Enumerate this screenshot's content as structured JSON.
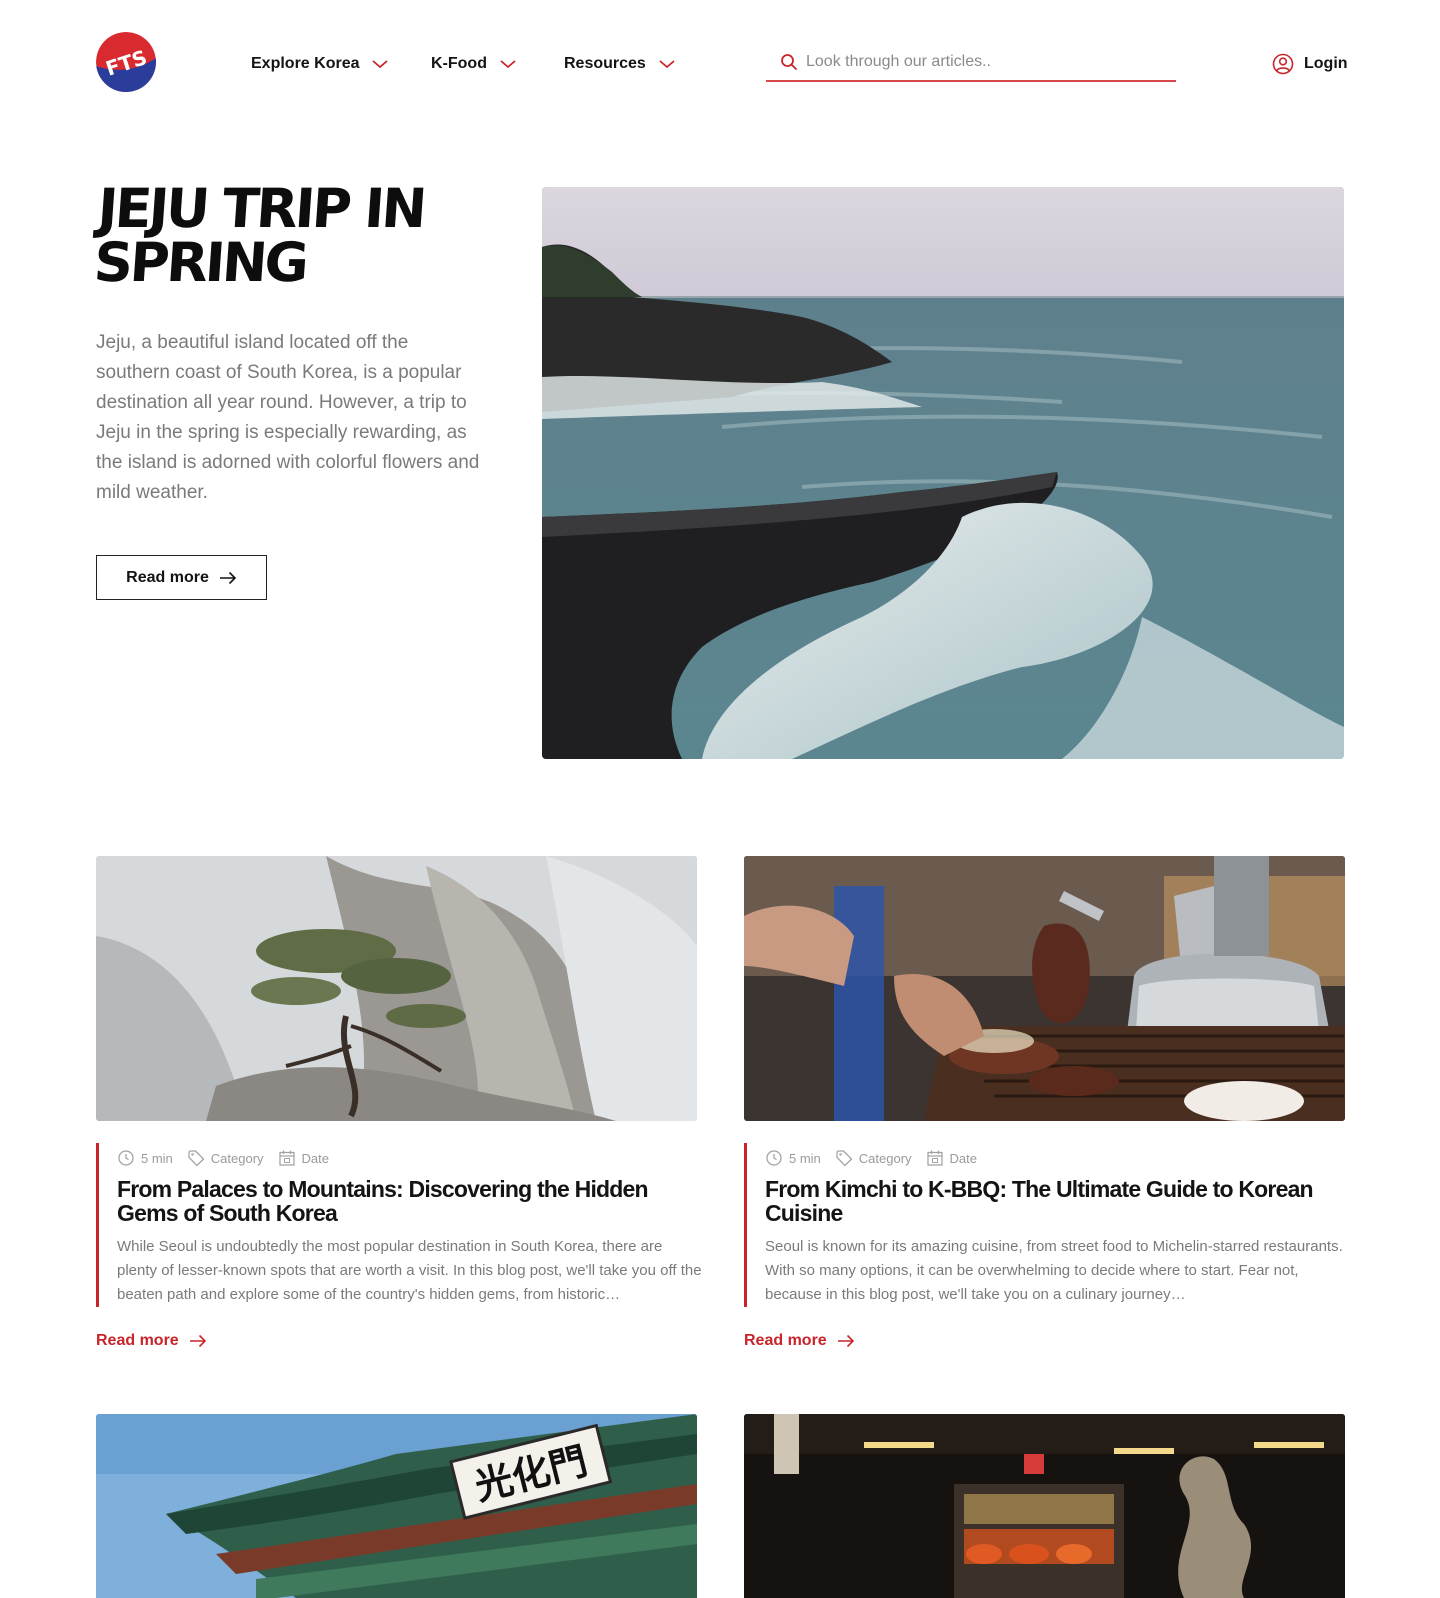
{
  "header": {
    "logo_text": "FTS",
    "nav": [
      {
        "label": "Explore Korea"
      },
      {
        "label": "K-Food"
      },
      {
        "label": "Resources"
      }
    ],
    "search": {
      "placeholder": "Look through our articles.."
    },
    "login_label": "Login"
  },
  "hero": {
    "title": "Jeju Trip in Spring",
    "description": "Jeju, a beautiful island located off the southern coast of South Korea, is a popular destination all year round. However, a trip to Jeju in the spring is especially rewarding, as the island is adorned with colorful flowers and mild weather.",
    "cta_label": "Read more"
  },
  "articles": [
    {
      "read_time": "5 min",
      "category": "Category",
      "date": "Date",
      "title": "From Palaces to Mountains: Discovering the Hidden Gems of South Korea",
      "excerpt": "While Seoul is undoubtedly the most popular destination in South Korea, there are plenty of lesser-known spots that are worth a visit. In this blog post, we'll take you off the beaten path and explore some of the country's hidden gems, from historic…",
      "read_more": "Read more"
    },
    {
      "read_time": "5 min",
      "category": "Category",
      "date": "Date",
      "title": "From Kimchi to K-BBQ: The Ultimate Guide to Korean Cuisine",
      "excerpt": "Seoul is known for its amazing cuisine, from street food to Michelin-starred restaurants. With so many options, it can be overwhelming to decide where to start. Fear not, because in this blog post, we'll take you on a culinary journey…",
      "read_more": "Read more"
    }
  ],
  "gate_sign": "光化門",
  "colors": {
    "accent": "#c8252b",
    "search_underline": "#d8474b",
    "text_dark": "#141414",
    "text_muted": "#7a7a7a",
    "logo_red": "#d92a2f",
    "logo_blue": "#2a3d9a"
  },
  "icons": {
    "nav_chevron": "chevron-down-icon",
    "search": "search-icon",
    "login": "user-circle-icon",
    "arrow": "arrow-right-icon",
    "time": "clock-icon",
    "category": "tag-icon",
    "date": "calendar-icon"
  }
}
